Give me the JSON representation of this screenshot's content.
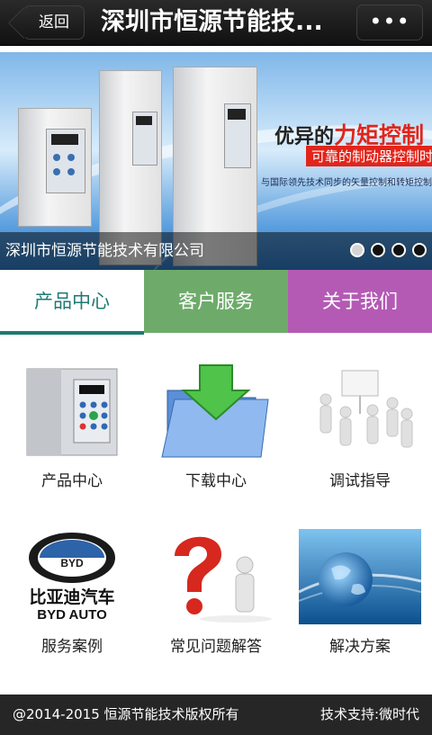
{
  "header": {
    "back_label": "返回",
    "title": "深圳市恒源节能技...",
    "more_label": "•••"
  },
  "banner": {
    "slogan_main_prefix": "优异的",
    "slogan_main_highlight": "力矩控制",
    "slogan_sub": "可靠的制动器控制时序",
    "slogan_small": "与国际领先技术同步的矢量控制和转矩控制技术",
    "caption": "深圳市恒源节能技术有限公司",
    "slide_count": 4,
    "active_slide": 1
  },
  "tabs": [
    {
      "label": "产品中心",
      "color": "#ffffff",
      "text_color": "#1e7a73"
    },
    {
      "label": "客户服务",
      "color": "#6eab6a"
    },
    {
      "label": "关于我们",
      "color": "#b45ab5"
    }
  ],
  "grid": [
    {
      "label": "产品中心",
      "icon": "inverter-product-image"
    },
    {
      "label": "下载中心",
      "icon": "download-folder-icon"
    },
    {
      "label": "调试指导",
      "icon": "presentation-figures-image"
    },
    {
      "label": "服务案例",
      "icon": "byd-logo-image",
      "logo_text_cn": "比亚迪汽车",
      "logo_text_en": "BYD AUTO",
      "logo_badge": "BYD"
    },
    {
      "label": "常见问题解答",
      "icon": "question-mark-image"
    },
    {
      "label": "解决方案",
      "icon": "globe-network-image"
    }
  ],
  "footer": {
    "copyright": "@2014-2015 恒源节能技术版权所有",
    "support": "技术支持:微时代"
  },
  "colors": {
    "topbar": "#1a1a1a",
    "accent": "#1e7a73",
    "footer": "#262626"
  }
}
